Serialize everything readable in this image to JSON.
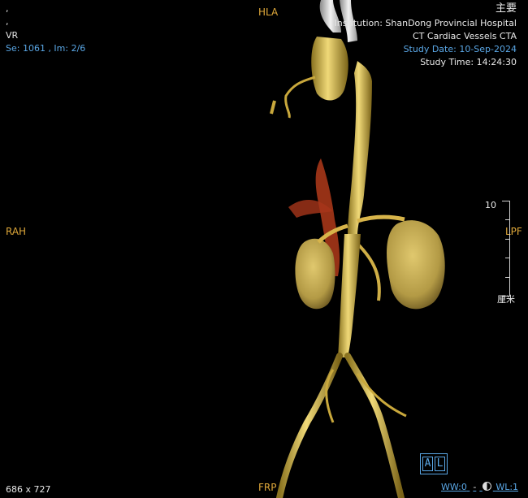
{
  "top_left": {
    "line1": ",",
    "line2": ",",
    "render_mode": "VR",
    "series_image": "Se: 1061  ,  Im: 2/6"
  },
  "top_right": {
    "menu_label": "主要",
    "institution": "Institution: ShanDong Provincial Hospital",
    "study_desc": "CT Cardiac Vessels CTA",
    "study_date": "Study Date: 10-Sep-2024",
    "study_time": "Study Time: 14:24:30"
  },
  "orientation": {
    "top": "HLA",
    "left": "RAH",
    "right": "LPF",
    "bottom": "FRP"
  },
  "scale": {
    "value": "10",
    "unit": "厘米"
  },
  "bottom_left": {
    "dimensions": "686  x  727"
  },
  "bottom_right": {
    "al_a": "A",
    "al_l": "L",
    "ww": "WW:0",
    "wl": "WL:1",
    "separator": "-"
  },
  "colors": {
    "overlay_text": "#e8e8e8",
    "accent_blue": "#5aa7e6",
    "orientation_orange": "#e0a93a",
    "vessel": "#d9b94a",
    "kidney": "#cdb35a",
    "background": "#000000"
  }
}
